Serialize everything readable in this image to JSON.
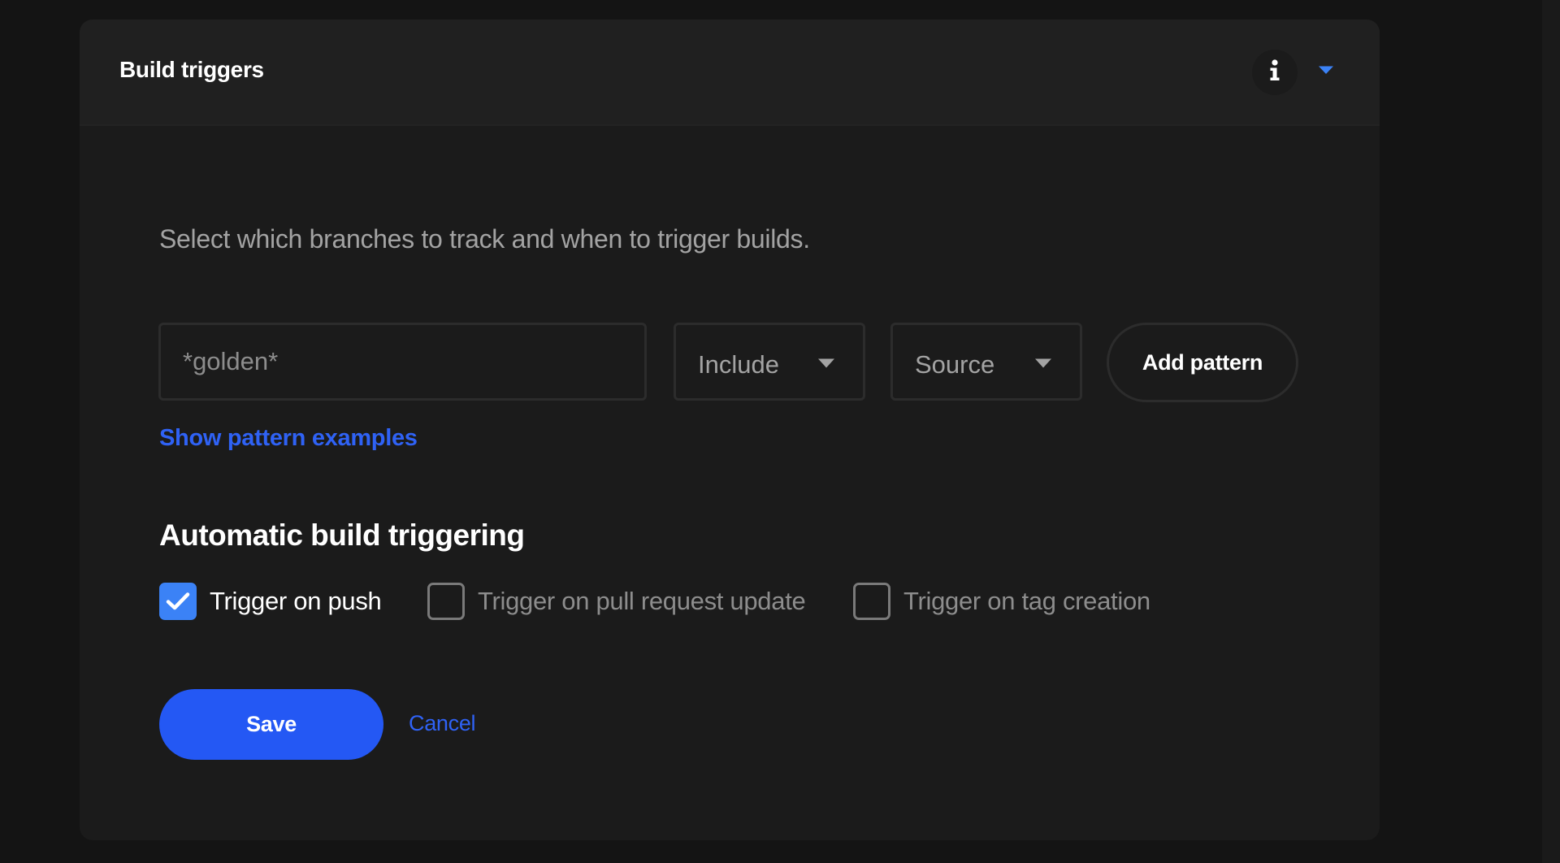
{
  "panel": {
    "title": "Build triggers",
    "info_icon": "info-icon",
    "collapse_icon": "caret-down-icon",
    "accent_color": "#3b82f6"
  },
  "description": "Select which branches to track and when to trigger builds.",
  "pattern_form": {
    "pattern_placeholder": "*golden*",
    "pattern_value": "",
    "mode_select": {
      "selected": "Include"
    },
    "ref_select": {
      "selected": "Source"
    },
    "add_button_label": "Add pattern",
    "examples_link": "Show pattern examples",
    "link_color": "#2f62f5"
  },
  "automatic": {
    "title": "Automatic build triggering",
    "options": [
      {
        "label": "Trigger on push",
        "checked": true
      },
      {
        "label": "Trigger on pull request update",
        "checked": false
      },
      {
        "label": "Trigger on tag creation",
        "checked": false
      }
    ]
  },
  "actions": {
    "save_label": "Save",
    "cancel_label": "Cancel",
    "save_color": "#2458f4"
  }
}
